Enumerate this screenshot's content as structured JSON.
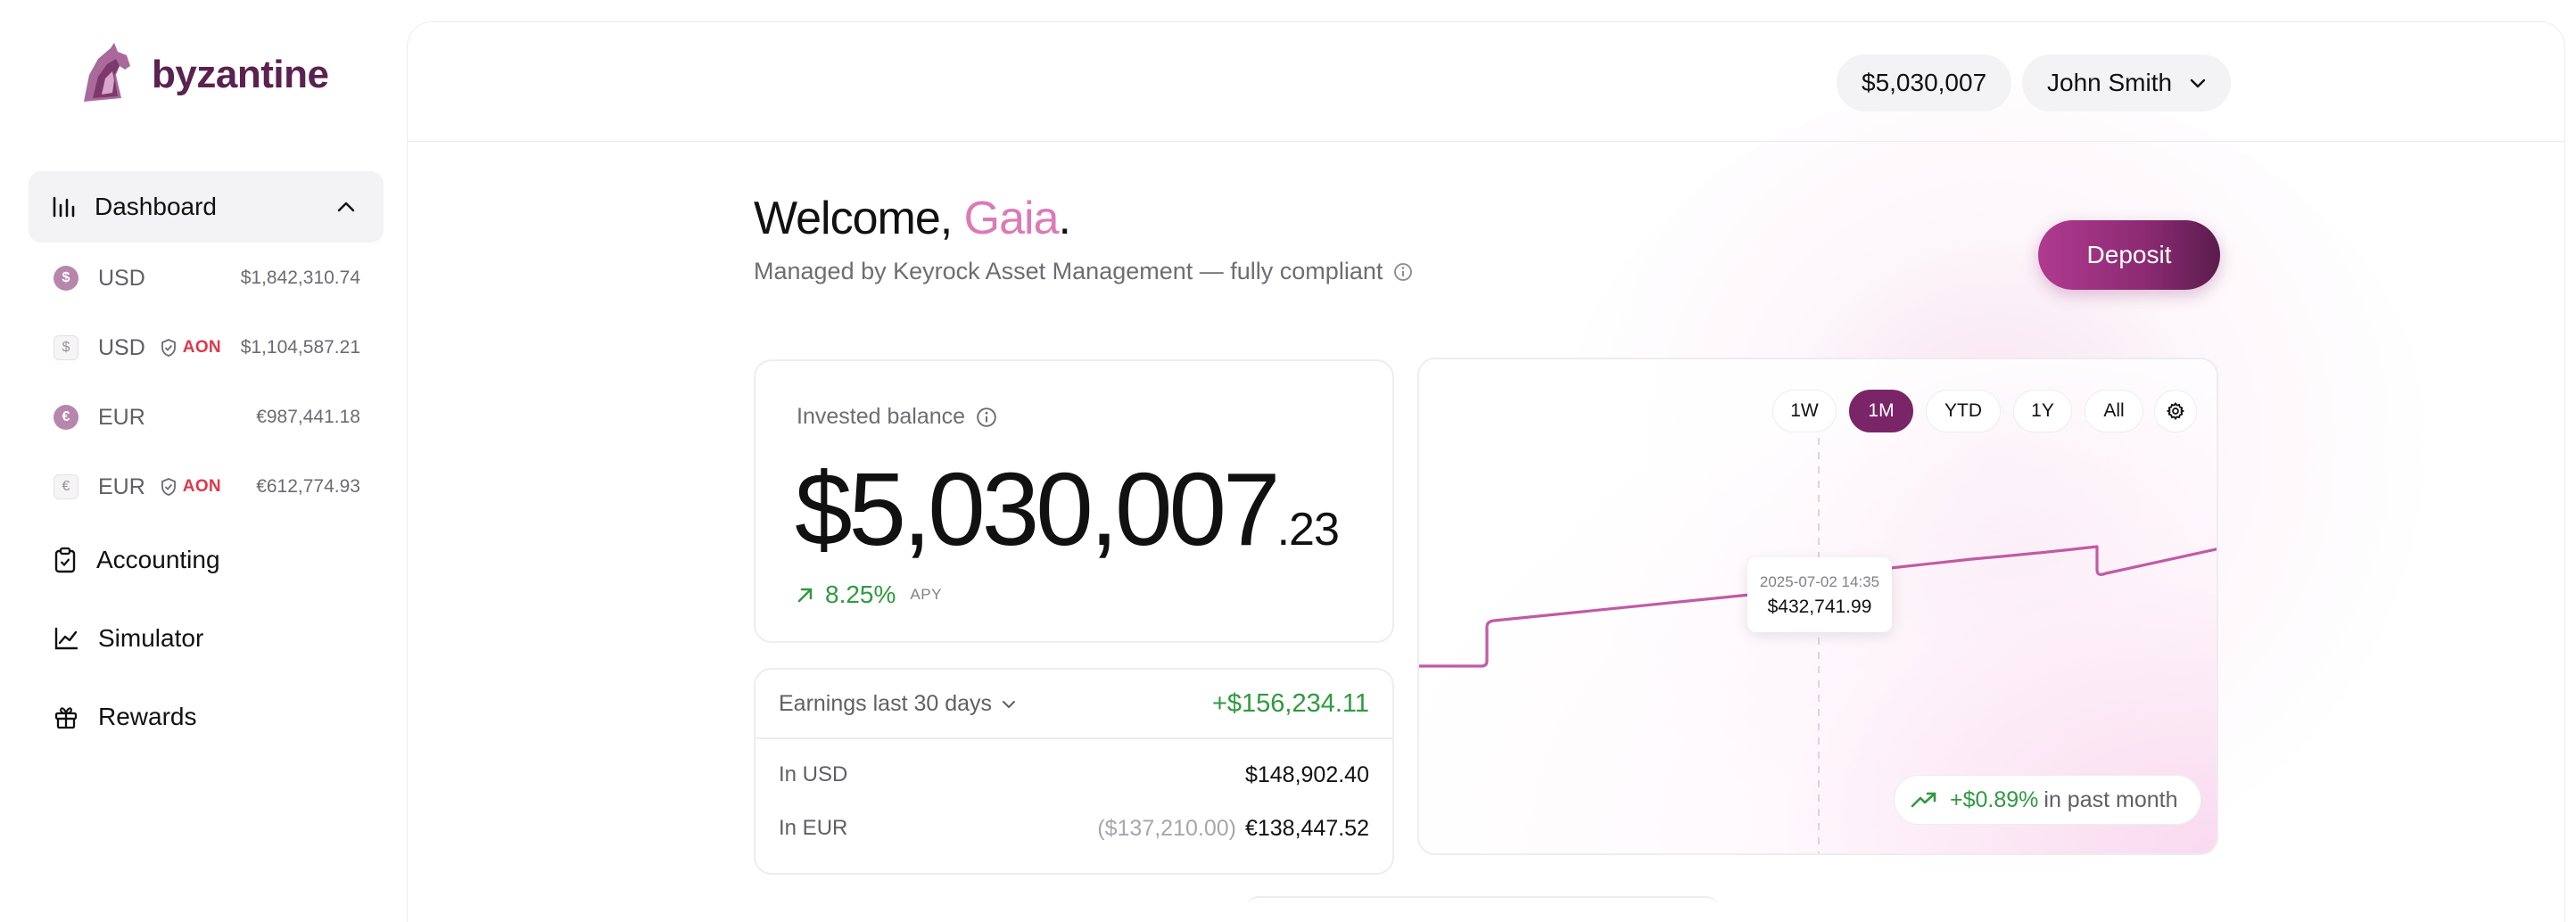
{
  "brand": {
    "name": "byzantine",
    "logo_icon": "horse-head-logo"
  },
  "sidebar": {
    "dashboard": {
      "label": "Dashboard",
      "icon": "bar-chart-icon"
    },
    "accounts": [
      {
        "currency": "USD",
        "symbol": "$",
        "style": "solid",
        "partner": "",
        "amount": "$1,842,310.74"
      },
      {
        "currency": "USD",
        "symbol": "$",
        "style": "outline",
        "partner": "AON",
        "amount": "$1,104,587.21"
      },
      {
        "currency": "EUR",
        "symbol": "€",
        "style": "solid",
        "partner": "",
        "amount": "€987,441.18"
      },
      {
        "currency": "EUR",
        "symbol": "€",
        "style": "outline",
        "partner": "AON",
        "amount": "€612,774.93"
      }
    ],
    "items": [
      {
        "label": "Accounting",
        "icon": "clipboard-icon"
      },
      {
        "label": "Simulator",
        "icon": "line-chart-icon"
      },
      {
        "label": "Rewards",
        "icon": "gift-icon"
      }
    ]
  },
  "header": {
    "balance_pill": "$5,030,007",
    "user_name": "John Smith"
  },
  "welcome": {
    "prefix": "Welcome, ",
    "name": "Gaia",
    "suffix": ".",
    "subtitle": "Managed by Keyrock Asset Management — fully compliant"
  },
  "deposit_label": "Deposit",
  "balance_card": {
    "label": "Invested balance",
    "whole": "$5,030,007",
    "cents": ".23",
    "apy": "8.25%",
    "apy_tag": "APY"
  },
  "earnings": {
    "label": "Earnings last 30 days",
    "total": "+$156,234.11",
    "rows": [
      {
        "label": "In USD",
        "muted": "",
        "value": "$148,902.40"
      },
      {
        "label": "In EUR",
        "muted": "($137,210.00)",
        "value": "€138,447.52"
      }
    ]
  },
  "chart_data": {
    "type": "line",
    "ranges": [
      "1W",
      "1M",
      "YTD",
      "1Y",
      "All"
    ],
    "active_range": "1M",
    "tooltip": {
      "date": "2025-07-02 14:35",
      "value": "$432,741.99"
    },
    "performance": {
      "value": "+$0.89%",
      "suffix": "in past month"
    },
    "colors": {
      "line": "#c25aa5",
      "active": "#7a2568",
      "positive": "#2f9a3f"
    }
  }
}
